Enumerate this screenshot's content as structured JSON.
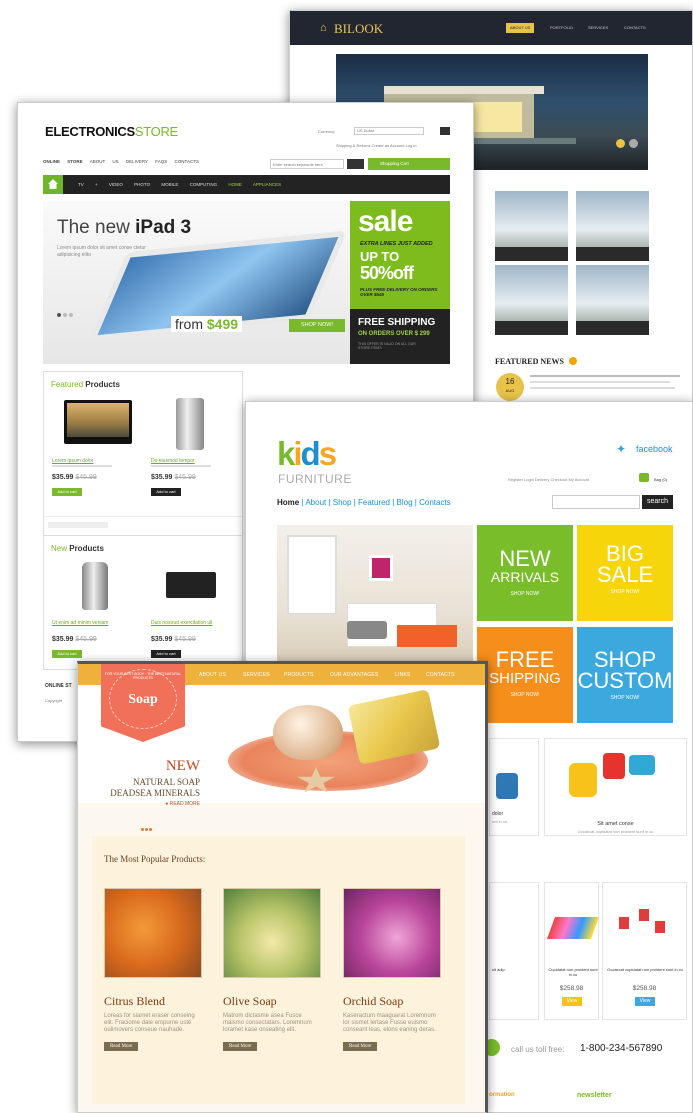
{
  "bilook": {
    "logo": "BILOOK",
    "nav": [
      "ABOUT US",
      "PORTFOLIO",
      "SERVICES",
      "CONTACTS"
    ],
    "featured_news": "FEATURED NEWS",
    "news_day": "16",
    "news_month": "AUG"
  },
  "electronics": {
    "title_a": "ELECTRONICS",
    "title_b": "STORE",
    "currency_label": "Currency:",
    "currency_value": "US Dollar",
    "top_links": "Shipping & Returns   Create an Account   Log in",
    "nav": [
      "ONLINE STORE",
      "ABOUT US",
      "DELIVERY",
      "FAQS",
      "CONTACTS"
    ],
    "search_placeholder": "Enter search keywords here",
    "cart": "Shopping Cart",
    "categories": [
      "TV + VIDEO",
      "PHOTO",
      "MOBILE",
      "COMPUTING",
      "HOME APPLIANCES"
    ],
    "banner_title_a": "The new ",
    "banner_title_b": "iPad 3",
    "banner_text": "Lorem ipsum dolor sit amet conse ctetur adipisicing elito",
    "from_text": "from ",
    "price": "$499",
    "shop_now": "SHOP NOW!",
    "sale": "sale",
    "extra_lines": "EXTRA LINES JUST ADDED",
    "up_to": "UP TO",
    "percent": "50%off",
    "free_delivery": "PLUS FREE DELIVERY ON ORDERS OVER $545",
    "free_shipping": "FREE SHIPPING",
    "orders_over": "ON ORDERS OVER $ 299",
    "offer_note": "THIS OFFER IS VALID ON ALL OUR STORE ITEMS",
    "featured_a": "Featured ",
    "featured_b": "Products",
    "new_a": "New ",
    "new_b": "Products",
    "featured_items": [
      {
        "name": "Lorem ipsum dolor",
        "price": "$35.99",
        "old": "$45.99"
      },
      {
        "name": "Do eiusmod tempor",
        "price": "$35.99",
        "old": "$45.99"
      }
    ],
    "new_items": [
      {
        "name": "Ut enim ad minim veniam",
        "price": "$35.99",
        "old": "$45.99"
      },
      {
        "name": "Duis nostrud exercitation ull",
        "price": "$35.99",
        "old": "$45.99"
      }
    ],
    "add_to_cart": "Add to cart",
    "online_store": "ONLINE ST",
    "copyright": "Copyright"
  },
  "kids": {
    "logo": "kids",
    "furniture": "FURNITURE",
    "facebook": "facebook",
    "links": "Register  Login  Delivery  Checkout  My Account",
    "bag": "Bag (0)",
    "nav": [
      "Home",
      "About",
      "Shop",
      "Featured",
      "Blog",
      "Contacts"
    ],
    "search": "search",
    "tiles": [
      {
        "big": "NEW",
        "mid": "ARRIVALS",
        "sm": "SHOP NOW!",
        "color": "#79bd2b"
      },
      {
        "big": "BIG",
        "mid": "SALE",
        "sm": "SHOP NOW!",
        "color": "#f6d60a"
      },
      {
        "big": "FREE",
        "mid": "SHIPPING",
        "sm": "SHOP NOW!",
        "color": "#f58e1a"
      },
      {
        "big": "SHOP",
        "mid": "CUSTOM",
        "sm": "SHOP NOW!",
        "color": "#3ba9dd"
      }
    ],
    "p1": "dolor",
    "p1d": "unt in cu",
    "p2": "Sit amet conse",
    "p2d": "Occaecat cupidatat non proident sunt in cu",
    "p3": "sit adip.",
    "p4": "Cupidatat non proident sunt in cu",
    "p5": "Occaecat cupidatat non proident sunt in cu",
    "price1": "$258.98",
    "price2": "$258.98",
    "view": "View",
    "call": "call us toll free:",
    "phone": "1-800-234-567890",
    "formation": "ormation",
    "newsletter": "newsletter"
  },
  "soap": {
    "nav": [
      "ABOUT US",
      "SERVICES",
      "PRODUCTS",
      "OUR ADVANTAGES",
      "LINKS",
      "CONTACTS"
    ],
    "badge": "Soap",
    "badge_ring": "FOR YOUR BEST BODY · THE BEST NATURAL PRODUCTS",
    "new": "NEW",
    "line1": "NATURAL SOAP",
    "line2": "DEADSEA MINERALS",
    "read_more_hero": "● READ MORE",
    "popular_title": "The Most Popular Products:",
    "products": [
      {
        "name": "Citrus Blend",
        "desc": "Loreas for siamet eraser conseing elit. Fraciome daie empurne usté oulimovers conseue nauhade."
      },
      {
        "name": "Olive Soap",
        "desc": "Matrom dictasme asea Fusce maismo consectatars. Loremnum loramet kase onseating elit."
      },
      {
        "name": "Orchid Soap",
        "desc": "Kaseractum maaguarat Loremnum lor sismet lertase Fusse euismo conseant leas, elons eaning deras."
      }
    ],
    "read_more": "Read More"
  },
  "colors": {
    "green": "#7ebc1e",
    "orange": "#f6a623",
    "blue": "#1b8fd0",
    "gold": "#eeb13b"
  }
}
